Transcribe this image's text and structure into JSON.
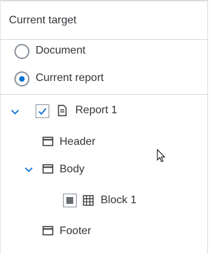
{
  "panel": {
    "title": "Current target"
  },
  "target_options": [
    {
      "label": "Document",
      "selected": false
    },
    {
      "label": "Current report",
      "selected": true
    }
  ],
  "tree": {
    "report": {
      "label": "Report 1",
      "checked": true,
      "expanded": true,
      "icon": "report-document-icon"
    },
    "header": {
      "label": "Header",
      "icon": "section-frame-icon"
    },
    "body": {
      "label": "Body",
      "expanded": true,
      "icon": "section-frame-icon"
    },
    "block": {
      "label": "Block 1",
      "state": "partial",
      "icon": "table-grid-icon"
    },
    "footer": {
      "label": "Footer",
      "icon": "section-frame-icon"
    }
  },
  "colors": {
    "accent": "#0a6ed1",
    "text": "#32363a",
    "border": "#89919a"
  }
}
